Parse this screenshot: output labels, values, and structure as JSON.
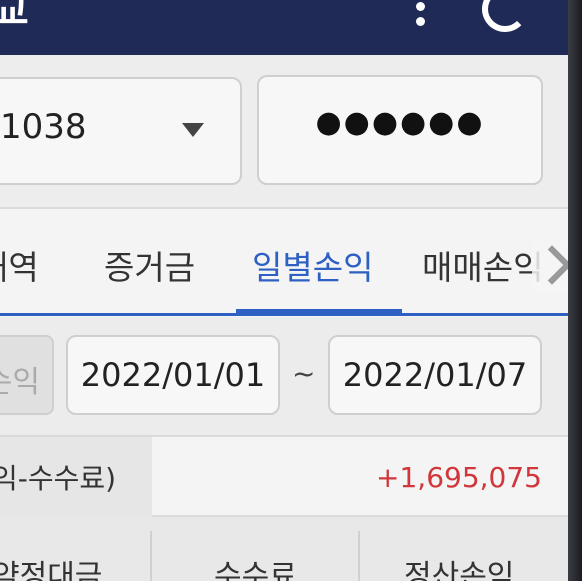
{
  "header": {
    "title_fragment": "교",
    "more_icon": "vertical-dots-icon",
    "refresh_icon": "refresh-icon",
    "background": "#1f2a56"
  },
  "account": {
    "number": "1038",
    "password_mask": "●●●●●●"
  },
  "tabs": [
    {
      "label": "내역"
    },
    {
      "label": "증거금"
    },
    {
      "label": "일별손익",
      "active": true
    },
    {
      "label": "매매손익"
    }
  ],
  "filter": {
    "type_label": "손익",
    "start_date": "2022/01/01",
    "separator": "~",
    "end_date": "2022/01/07"
  },
  "summary": {
    "label": "익-수수료)",
    "value": "+1,695,075",
    "value_color": "#d0363a"
  },
  "columns": [
    "약정대금",
    "수수료",
    "정산손익"
  ],
  "accent_color": "#2e5fc2"
}
